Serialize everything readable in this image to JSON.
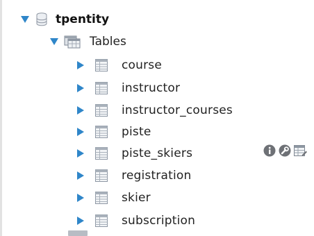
{
  "tree": {
    "schema": {
      "name": "tpentity",
      "expanded": true,
      "icon": "database-icon"
    },
    "tables_node": {
      "label": "Tables",
      "expanded": true,
      "icon": "tables-folder-icon"
    },
    "tables": [
      {
        "name": "course"
      },
      {
        "name": "instructor"
      },
      {
        "name": "instructor_courses"
      },
      {
        "name": "piste"
      },
      {
        "name": "piste_skiers",
        "hovered": true
      },
      {
        "name": "registration"
      },
      {
        "name": "skier"
      },
      {
        "name": "subscription"
      }
    ],
    "hover_actions": [
      "info-icon",
      "wrench-icon",
      "table-data-icon"
    ]
  },
  "colors": {
    "arrow": "#2f86c9",
    "grid_icon": "#8c96a3",
    "info_icon": "#6e7176",
    "text": "#222222"
  }
}
